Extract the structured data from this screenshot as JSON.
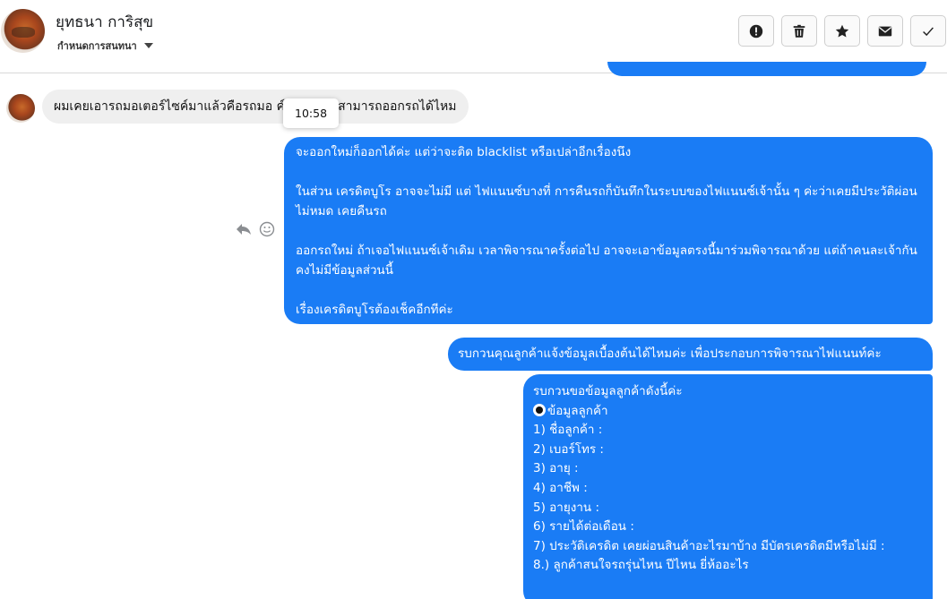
{
  "header": {
    "contact_name": "ยุทธนา การิสุข",
    "status_label": "กำหนดการสนทนา",
    "actions": {
      "report_icon": "alert-circle-icon",
      "delete_icon": "trash-icon",
      "star_icon": "star-icon",
      "mark_unread_icon": "envelope-icon",
      "done_icon": "check-icon"
    }
  },
  "thread": {
    "incoming": {
      "text": "ผมเคยเอารถมอเตอร์ไซค์มาแล้วคือรถมอ         ค์อ่ะครับผมสามารถออกรถได้ไหม",
      "tooltip_time": "10:58"
    },
    "message_actions": {
      "reply_icon": "reply-icon",
      "react_icon": "smiley-icon"
    },
    "outgoing_1": {
      "paragraphs": [
        "จะออกใหม่ก็ออกได้ค่ะ แต่ว่าจะติด blacklist หรือเปล่าอีกเรื่องนึง",
        "ในส่วน เครดิตบูโร อาจจะไม่มี แต่ ไฟแนนซ์บางที่ การคืนรถก็บันทึกในระบบของไฟแนนซ์เจ้านั้น ๆ ค่ะว่าเคยมีประวัติผ่อนไม่หมด เคยคืนรถ",
        "ออกรถใหม่ ถ้าเจอไฟแนนซ์เจ้าเดิม เวลาพิจารณาครั้งต่อไป อาจจะเอาข้อมูลตรงนี้มาร่วมพิจารณาด้วย แต่ถ้าคนละเจ้ากันคงไม่มีข้อมูลส่วนนี้",
        "เรื่องเครดิตบูโรต้องเช็คอีกทีค่ะ"
      ]
    },
    "outgoing_2": {
      "text": "รบกวนคุณลูกค้าแจ้งข้อมูลเบื้องต้นได้ไหมค่ะ เพื่อประกอบการพิจารณาไฟแนนท์ค่ะ"
    },
    "outgoing_3": {
      "title": "รบกวนขอข้อมูลลูกค้าดังนี้ค่ะ",
      "subtitle": "ข้อมูลลูกค้า",
      "items": [
        "1) ชื่อลูกค้า :",
        "2) เบอร์โทร :",
        "3) อายุ :",
        "4) อาชีพ :",
        "5) อายุงาน :",
        "6) รายได้ต่อเดือน :",
        "7) ประวัติเครดิต  เคยผ่อนสินค้าอะไรมาบ้าง มีบัตรเครดิตมีหรือไม่มี :",
        "8.) ลูกค้าสนใจรถรุ่นไหน ปีไหน ยี่ห้ออะไร"
      ]
    }
  },
  "colors": {
    "outgoing_bubble": "#1a7cf5",
    "incoming_bubble": "#efefef"
  }
}
